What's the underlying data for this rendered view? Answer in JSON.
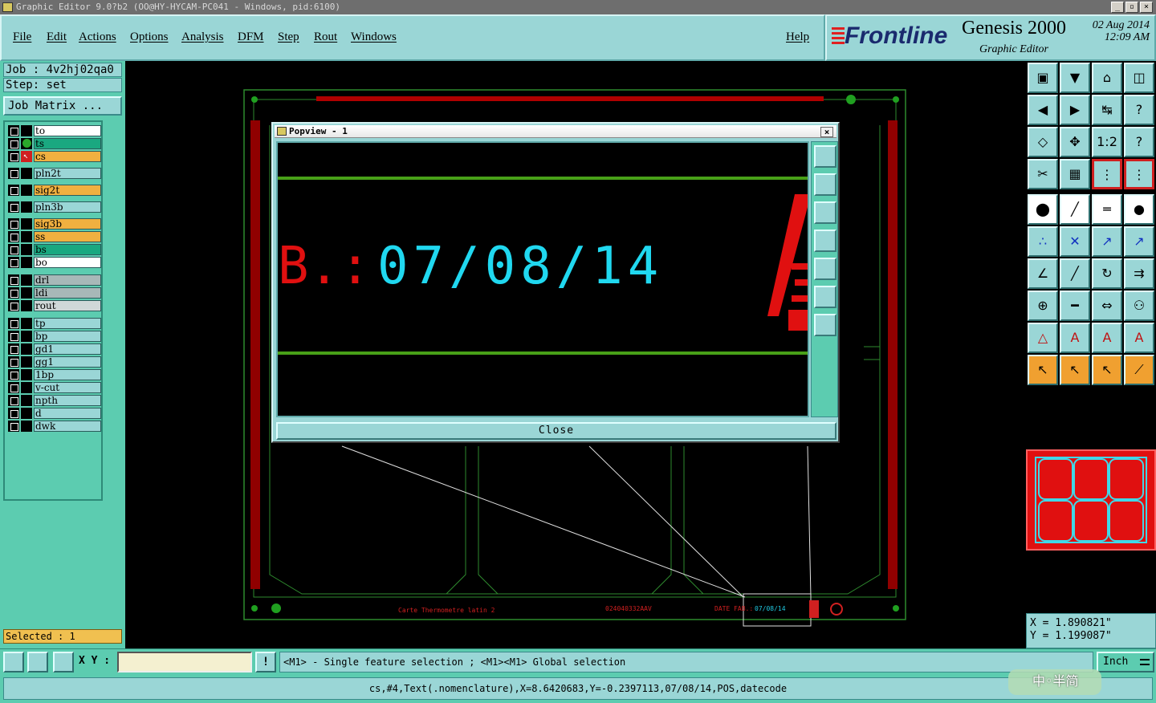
{
  "window": {
    "title": "Graphic Editor 9.0?b2 (OO@HY-HYCAM-PC041 - Windows, pid:6100)",
    "controls": [
      "_",
      "▫",
      "×"
    ]
  },
  "menu": {
    "items": [
      "File",
      "Edit",
      "Actions",
      "Options",
      "Analysis",
      "DFM",
      "Step",
      "Rout",
      "Windows"
    ],
    "help": "Help"
  },
  "brand": {
    "logo": "Frontline",
    "product": "Genesis 2000",
    "subtitle": "Graphic Editor",
    "date_line1": "02 Aug 2014",
    "date_line2": "12:09 AM"
  },
  "job": {
    "job_label": "Job : 4v2hj02qa0",
    "step_label": "Step: set",
    "job_matrix_button": "Job Matrix ..."
  },
  "layers": [
    {
      "name": "to",
      "color": "#ffffff",
      "mark": ""
    },
    {
      "name": "ts",
      "color": "#1aa880",
      "mark": "dot"
    },
    {
      "name": "cs",
      "color": "#f0b040",
      "mark": "work"
    },
    {
      "name": "pln2t",
      "color": "#9ad6d6",
      "mark": ""
    },
    {
      "name": "sig2t",
      "color": "#f0b040",
      "mark": ""
    },
    {
      "name": "pln3b",
      "color": "#9ad6d6",
      "mark": ""
    },
    {
      "name": "sig3b",
      "color": "#f0b040",
      "mark": ""
    },
    {
      "name": "ss",
      "color": "#f0b040",
      "mark": ""
    },
    {
      "name": "bs",
      "color": "#1aa880",
      "mark": ""
    },
    {
      "name": "bo",
      "color": "#ffffff",
      "mark": ""
    },
    {
      "name": "drl",
      "color": "#a8b8b8",
      "mark": ""
    },
    {
      "name": "ldi",
      "color": "#a8b8b8",
      "mark": ""
    },
    {
      "name": "rout",
      "color": "#d0d8d8",
      "mark": ""
    },
    {
      "name": "tp",
      "color": "#9ad6d6",
      "mark": ""
    },
    {
      "name": "bp",
      "color": "#9ad6d6",
      "mark": ""
    },
    {
      "name": "gd1",
      "color": "#9ad6d6",
      "mark": ""
    },
    {
      "name": "gg1",
      "color": "#9ad6d6",
      "mark": ""
    },
    {
      "name": "1bp",
      "color": "#9ad6d6",
      "mark": ""
    },
    {
      "name": "v-cut",
      "color": "#9ad6d6",
      "mark": ""
    },
    {
      "name": "npth",
      "color": "#9ad6d6",
      "mark": ""
    },
    {
      "name": "d",
      "color": "#9ad6d6",
      "mark": ""
    },
    {
      "name": "dwk",
      "color": "#9ad6d6",
      "mark": ""
    }
  ],
  "selection": {
    "label": "Selected : 1"
  },
  "board": {
    "text_left": "Carte Thermometre latin 2",
    "text_mid": "024040332AAV",
    "text_date_prefix": "DATE FAB.:",
    "text_date_value": "07/08/14"
  },
  "popview": {
    "title": "Popview - 1",
    "close_x": "×",
    "zoom_text_prefix": "B.:",
    "zoom_text_value": "07/08/14",
    "close_button": "Close"
  },
  "coords": {
    "x": "X = 1.890821\"",
    "y": "Y = 1.199087\""
  },
  "bottom": {
    "xy_label": "X Y :",
    "xy_value": "",
    "warn_icon": "!",
    "hint": "<M1> - Single feature selection ; <M1><M1> Global selection",
    "units": "Inch"
  },
  "status": {
    "feature_info": "cs,#4,Text(.nomenclature),X=8.6420683,Y=-0.2397113,07/08/14,POS,datecode"
  },
  "ime": {
    "label": "中◦半简"
  },
  "colors": {
    "panel": "#9ad6d6",
    "panel_dark": "#5cccb0",
    "outline_green": "#3a8a3a",
    "copper_red": "#e01010",
    "text_cyan": "#20e0f0"
  }
}
